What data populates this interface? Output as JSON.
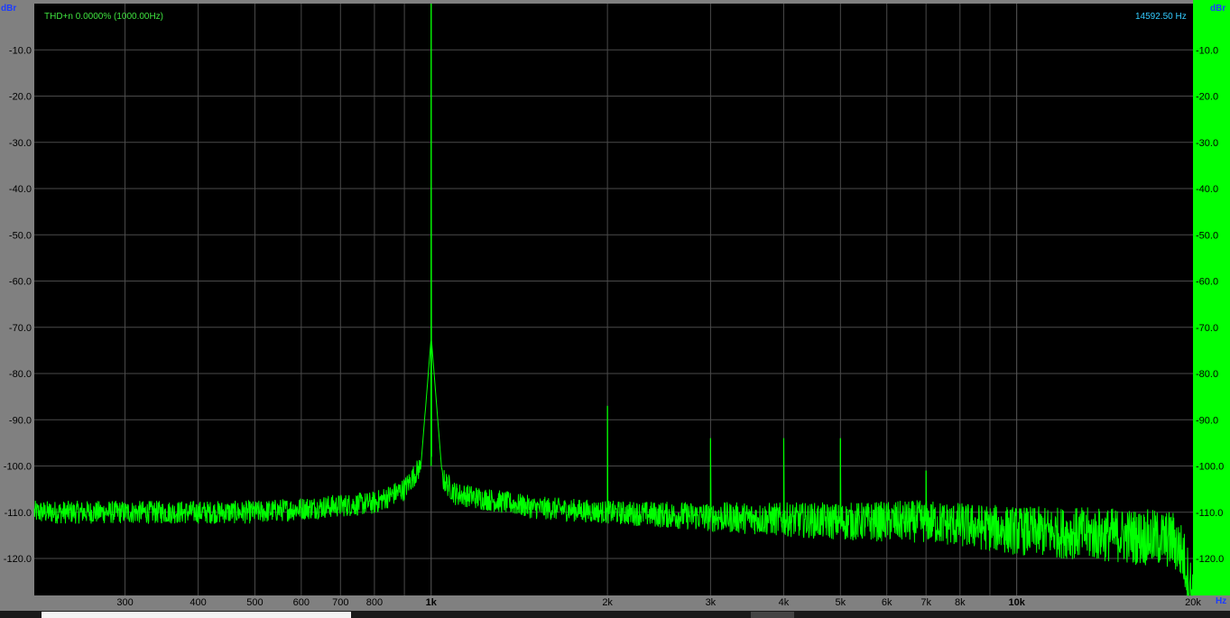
{
  "chart_data": {
    "type": "line",
    "title": "",
    "annotation_left": "THD+n 0.0000% (1000.00Hz)",
    "annotation_right": "14592.50 Hz",
    "ylabel": "dBr",
    "xlabel": "Hz",
    "x_scale": "log",
    "xlim": [
      210,
      20000
    ],
    "ylim": [
      -128,
      0
    ],
    "y_ticks": [
      {
        "value": -10,
        "label": "-10.0"
      },
      {
        "value": -20,
        "label": "-20.0"
      },
      {
        "value": -30,
        "label": "-30.0"
      },
      {
        "value": -40,
        "label": "-40.0"
      },
      {
        "value": -50,
        "label": "-50.0"
      },
      {
        "value": -60,
        "label": "-60.0"
      },
      {
        "value": -70,
        "label": "-70.0"
      },
      {
        "value": -80,
        "label": "-80.0"
      },
      {
        "value": -90,
        "label": "-90.0"
      },
      {
        "value": -100,
        "label": "-100.0"
      },
      {
        "value": -110,
        "label": "-110.0"
      },
      {
        "value": -120,
        "label": "-120.0"
      }
    ],
    "x_ticks": [
      {
        "value": 300,
        "label": "300",
        "bold": false
      },
      {
        "value": 400,
        "label": "400",
        "bold": false
      },
      {
        "value": 500,
        "label": "500",
        "bold": false
      },
      {
        "value": 600,
        "label": "600",
        "bold": false
      },
      {
        "value": 700,
        "label": "700",
        "bold": false
      },
      {
        "value": 800,
        "label": "800",
        "bold": false
      },
      {
        "value": 1000,
        "label": "1k",
        "bold": true
      },
      {
        "value": 2000,
        "label": "2k",
        "bold": false
      },
      {
        "value": 3000,
        "label": "3k",
        "bold": false
      },
      {
        "value": 4000,
        "label": "4k",
        "bold": false
      },
      {
        "value": 5000,
        "label": "5k",
        "bold": false
      },
      {
        "value": 6000,
        "label": "6k",
        "bold": false
      },
      {
        "value": 7000,
        "label": "7k",
        "bold": false
      },
      {
        "value": 8000,
        "label": "8k",
        "bold": false
      },
      {
        "value": 10000,
        "label": "10k",
        "bold": true
      },
      {
        "value": 20000,
        "label": "20k",
        "bold": false
      }
    ],
    "minor_grid_x": [
      900,
      9000
    ],
    "grid": true,
    "series": [
      {
        "color": "#00ff00",
        "noise_floor": [
          {
            "x": 210,
            "y": -110
          },
          {
            "x": 300,
            "y": -110
          },
          {
            "x": 500,
            "y": -110
          },
          {
            "x": 800,
            "y": -108
          },
          {
            "x": 900,
            "y": -105
          },
          {
            "x": 960,
            "y": -100
          },
          {
            "x": 1000,
            "y": -100
          },
          {
            "x": 1100,
            "y": -106
          },
          {
            "x": 1500,
            "y": -109
          },
          {
            "x": 2000,
            "y": -110
          },
          {
            "x": 3000,
            "y": -111
          },
          {
            "x": 5000,
            "y": -112
          },
          {
            "x": 7000,
            "y": -112
          },
          {
            "x": 10000,
            "y": -114
          },
          {
            "x": 15000,
            "y": -115
          },
          {
            "x": 18500,
            "y": -116
          },
          {
            "x": 19200,
            "y": -119
          },
          {
            "x": 20000,
            "y": -128
          }
        ],
        "peaks": [
          {
            "x": 1000,
            "y": 0
          },
          {
            "x": 2000,
            "y": -87
          },
          {
            "x": 3000,
            "y": -94
          },
          {
            "x": 4000,
            "y": -94
          },
          {
            "x": 5000,
            "y": -94
          },
          {
            "x": 7000,
            "y": -101
          }
        ]
      }
    ]
  }
}
